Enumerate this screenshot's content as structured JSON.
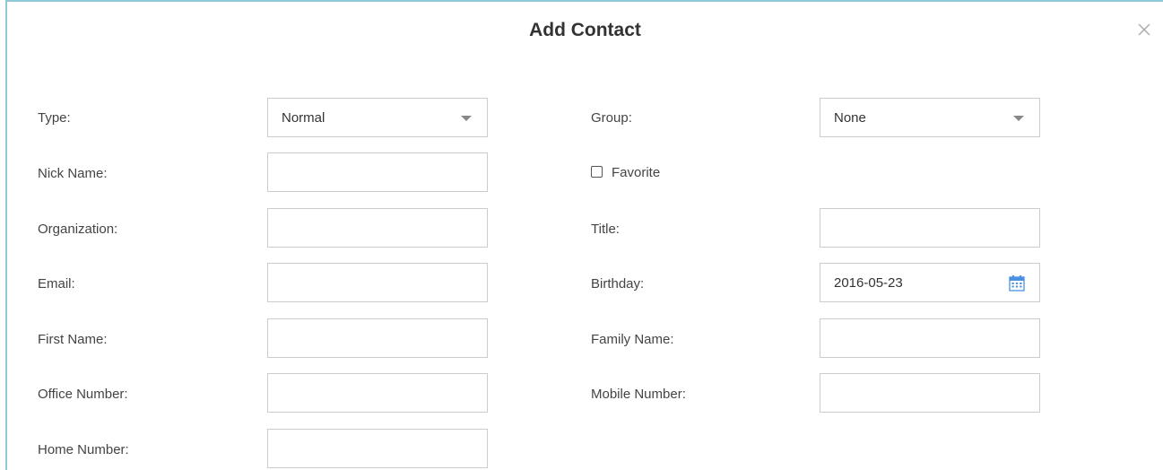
{
  "dialog": {
    "title": "Add Contact",
    "close_glyph": "close-icon"
  },
  "form": {
    "type": {
      "label": "Type:",
      "value": "Normal"
    },
    "nick_name": {
      "label": "Nick Name:",
      "value": ""
    },
    "organization": {
      "label": "Organization:",
      "value": ""
    },
    "email": {
      "label": "Email:",
      "value": ""
    },
    "first_name": {
      "label": "First Name:",
      "value": ""
    },
    "office_number": {
      "label": "Office Number:",
      "value": ""
    },
    "home_number": {
      "label": "Home Number:",
      "value": ""
    },
    "group": {
      "label": "Group:",
      "value": "None"
    },
    "favorite": {
      "label": "Favorite",
      "checked": false
    },
    "title": {
      "label": "Title:",
      "value": ""
    },
    "birthday": {
      "label": "Birthday:",
      "value": "2016-05-23"
    },
    "family_name": {
      "label": "Family Name:",
      "value": ""
    },
    "mobile_number": {
      "label": "Mobile Number:",
      "value": ""
    }
  },
  "colors": {
    "dialog_border": "#8fc9d6",
    "field_border": "#cccccc",
    "calendar_icon": "#4a90e2"
  }
}
